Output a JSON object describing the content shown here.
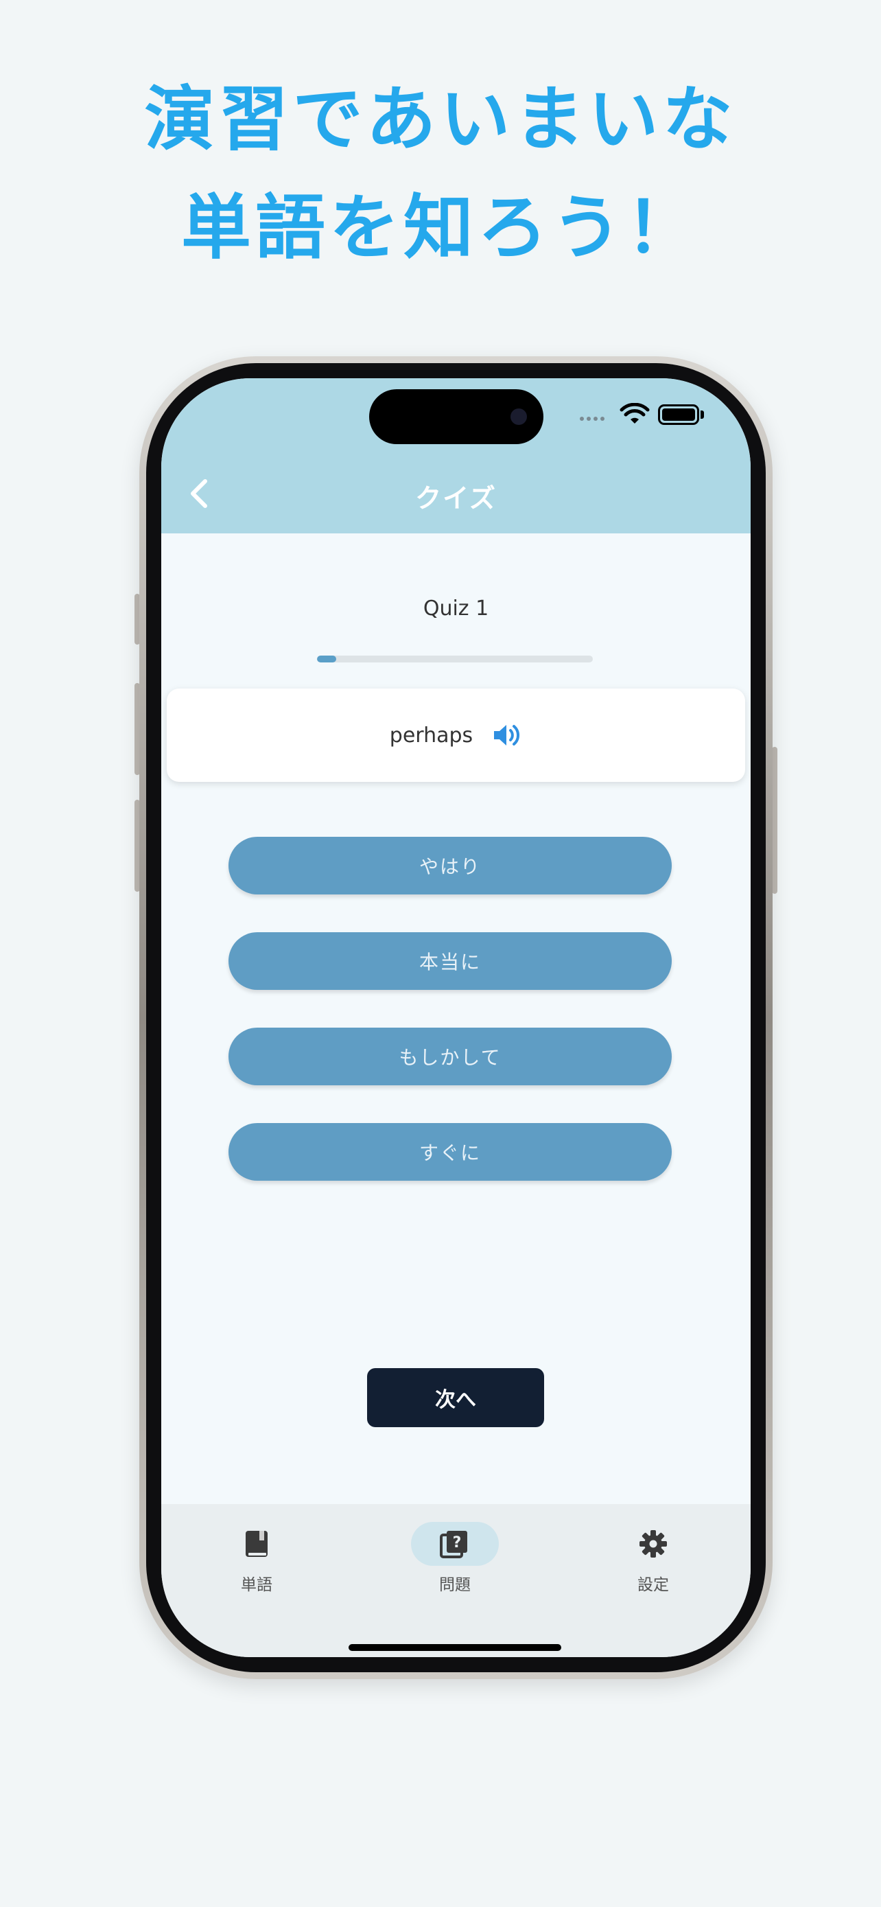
{
  "headline": {
    "line1": "演習であいまいな",
    "line2": "単語を知ろう！"
  },
  "nav": {
    "title": "クイズ",
    "back_icon": "chevron-left-icon"
  },
  "quiz": {
    "title": "Quiz 1",
    "progress": 0.07,
    "word": "perhaps",
    "speaker_icon": "speaker-icon",
    "choices": [
      "やはり",
      "本当に",
      "もしかして",
      "すぐに"
    ],
    "next_label": "次へ"
  },
  "tabs": [
    {
      "label": "単語",
      "icon": "book-icon",
      "active": false
    },
    {
      "label": "問題",
      "icon": "quiz-cards-icon",
      "active": true
    },
    {
      "label": "設定",
      "icon": "gear-icon",
      "active": false
    }
  ],
  "colors": {
    "accent": "#25a8ec",
    "header": "#add8e5",
    "choice": "#5f9dc4",
    "next_button": "#121f33",
    "background": "#f2f6f7"
  }
}
